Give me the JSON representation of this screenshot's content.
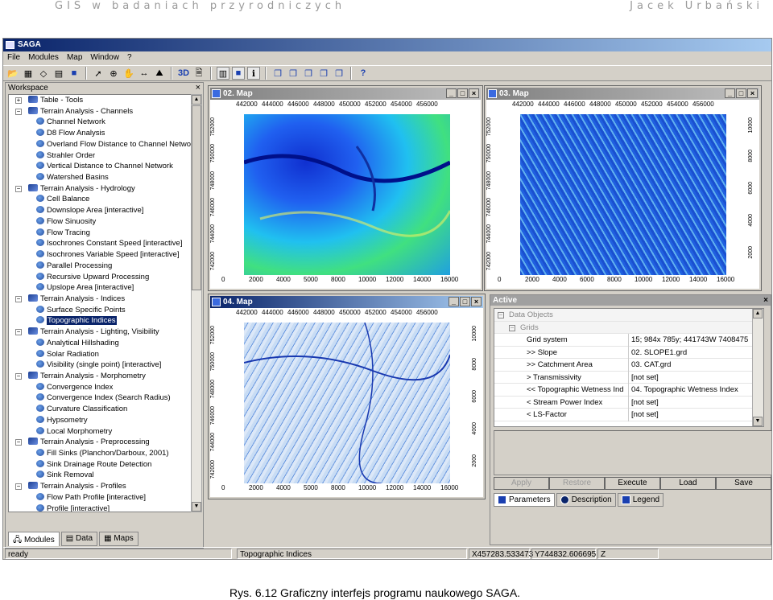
{
  "page_header": {
    "left": "GIS w badaniach przyrodniczych",
    "right": "Jacek Urbański"
  },
  "app": {
    "title": "SAGA"
  },
  "menu": [
    "File",
    "Modules",
    "Map",
    "Window",
    "?"
  ],
  "workspace": {
    "title": "Workspace",
    "close": "×",
    "tree": [
      {
        "t": "grp",
        "label": "Table - Tools",
        "box": "+"
      },
      {
        "t": "grp",
        "label": "Terrain Analysis - Channels",
        "box": "−"
      },
      {
        "t": "leaf",
        "label": "Channel Network"
      },
      {
        "t": "leaf",
        "label": "D8 Flow Analysis"
      },
      {
        "t": "leaf",
        "label": "Overland Flow Distance to Channel Netwo"
      },
      {
        "t": "leaf",
        "label": "Strahler Order"
      },
      {
        "t": "leaf",
        "label": "Vertical Distance to Channel Network"
      },
      {
        "t": "leaf",
        "label": "Watershed Basins"
      },
      {
        "t": "grp",
        "label": "Terrain Analysis - Hydrology",
        "box": "−"
      },
      {
        "t": "leaf",
        "label": "Cell Balance"
      },
      {
        "t": "leaf",
        "label": "Downslope Area [interactive]"
      },
      {
        "t": "leaf",
        "label": "Flow Sinuosity"
      },
      {
        "t": "leaf",
        "label": "Flow Tracing"
      },
      {
        "t": "leaf",
        "label": "Isochrones Constant Speed [interactive]"
      },
      {
        "t": "leaf",
        "label": "Isochrones Variable Speed [interactive]"
      },
      {
        "t": "leaf",
        "label": "Parallel Processing"
      },
      {
        "t": "leaf",
        "label": "Recursive Upward Processing"
      },
      {
        "t": "leaf",
        "label": "Upslope Area [interactive]"
      },
      {
        "t": "grp",
        "label": "Terrain Analysis - Indices",
        "box": "−"
      },
      {
        "t": "leaf",
        "label": "Surface Specific Points"
      },
      {
        "t": "leaf",
        "label": "Topographic Indices",
        "hl": true
      },
      {
        "t": "grp",
        "label": "Terrain Analysis - Lighting, Visibility",
        "box": "−"
      },
      {
        "t": "leaf",
        "label": "Analytical Hillshading"
      },
      {
        "t": "leaf",
        "label": "Solar Radiation"
      },
      {
        "t": "leaf",
        "label": "Visibility (single point) [interactive]"
      },
      {
        "t": "grp",
        "label": "Terrain Analysis - Morphometry",
        "box": "−"
      },
      {
        "t": "leaf",
        "label": "Convergence Index"
      },
      {
        "t": "leaf",
        "label": "Convergence Index (Search Radius)"
      },
      {
        "t": "leaf",
        "label": "Curvature Classification"
      },
      {
        "t": "leaf",
        "label": "Hypsometry"
      },
      {
        "t": "leaf",
        "label": "Local Morphometry"
      },
      {
        "t": "grp",
        "label": "Terrain Analysis - Preprocessing",
        "box": "−"
      },
      {
        "t": "leaf",
        "label": "Fill Sinks (Planchon/Darboux, 2001)"
      },
      {
        "t": "leaf",
        "label": "Sink Drainage Route Detection"
      },
      {
        "t": "leaf",
        "label": "Sink Removal"
      },
      {
        "t": "grp",
        "label": "Terrain Analysis - Profiles",
        "box": "−"
      },
      {
        "t": "leaf",
        "label": "Flow Path Profile [interactive]"
      },
      {
        "t": "leaf",
        "label": "Profile [interactive]"
      }
    ],
    "tabs": [
      "Modules",
      "Data",
      "Maps"
    ]
  },
  "maps": {
    "m02": {
      "title": "02. Map",
      "xtop": [
        "442000",
        "444000",
        "446000",
        "448000",
        "450000",
        "452000",
        "454000",
        "456000"
      ],
      "xbot": [
        "0",
        "2000",
        "4000",
        "5000",
        "8000",
        "10000",
        "12000",
        "14000",
        "16000"
      ],
      "yleft": [
        "752000",
        "750000",
        "748000",
        "746000",
        "744000",
        "742000"
      ]
    },
    "m03": {
      "title": "03. Map",
      "xtop": [
        "442000",
        "444000",
        "446000",
        "448000",
        "450000",
        "452000",
        "454000",
        "456000"
      ],
      "xbot": [
        "0",
        "2000",
        "4000",
        "6000",
        "8000",
        "10000",
        "12000",
        "14000",
        "16000"
      ],
      "yleft": [
        "752000",
        "750000",
        "748000",
        "746000",
        "744000",
        "742000"
      ],
      "yright": [
        "10000",
        "8000",
        "6000",
        "4000",
        "2000"
      ]
    },
    "m04": {
      "title": "04. Map",
      "xtop": [
        "442000",
        "444000",
        "446000",
        "448000",
        "450000",
        "452000",
        "454000",
        "456000"
      ],
      "xbot": [
        "0",
        "2000",
        "4000",
        "5000",
        "8000",
        "10000",
        "12000",
        "14000",
        "16000"
      ],
      "yleft": [
        "752000",
        "750000",
        "748000",
        "746000",
        "744000",
        "742000"
      ],
      "yright": [
        "10000",
        "8000",
        "6000",
        "4000",
        "2000"
      ]
    }
  },
  "active": {
    "title": "Active",
    "section1": "Data Objects",
    "section2": "Grids",
    "rows": [
      {
        "k": "Grid system",
        "v": "15; 984x 785y; 441743W 7408475"
      },
      {
        "k": ">> Slope",
        "v": "02. SLOPE1.grd"
      },
      {
        "k": ">> Catchment Area",
        "v": "03. CAT.grd"
      },
      {
        "k": "> Transmissivity",
        "v": "[not set]"
      },
      {
        "k": "<< Topographic Wetness Ind",
        "v": "04. Topographic Wetness Index"
      },
      {
        "k": "< Stream Power Index",
        "v": "[not set]"
      },
      {
        "k": "< LS-Factor",
        "v": "[not set]"
      }
    ],
    "buttons": [
      {
        "label": "Apply",
        "disabled": true
      },
      {
        "label": "Restore",
        "disabled": true
      },
      {
        "label": "Execute",
        "disabled": false
      },
      {
        "label": "Load",
        "disabled": false
      },
      {
        "label": "Save",
        "disabled": false
      }
    ],
    "tabs": [
      "Parameters",
      "Description",
      "Legend"
    ]
  },
  "status": {
    "s1": "ready",
    "s2": "Topographic Indices",
    "s3": "X457283.533473",
    "s4": "Y744832.606695",
    "s5": "Z"
  },
  "caption": "Rys. 6.12  Graficzny interfejs programu naukowego SAGA."
}
